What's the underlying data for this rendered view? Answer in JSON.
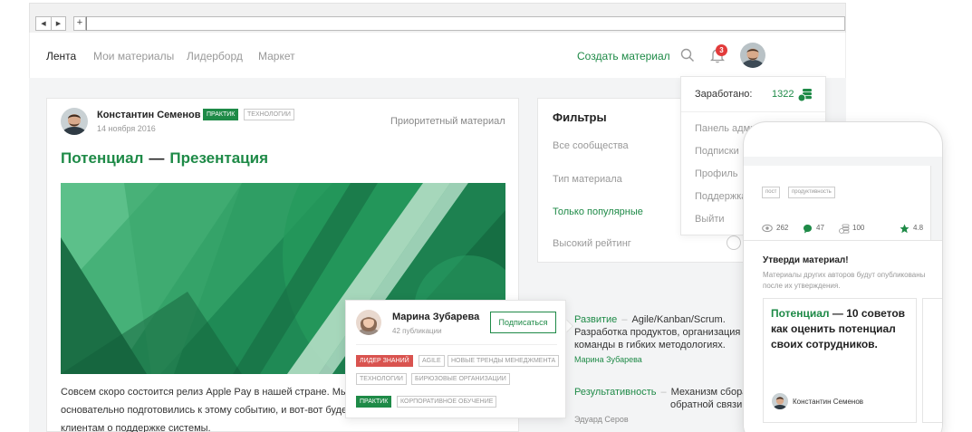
{
  "browser": {
    "back": "◀",
    "forward": "▶",
    "new_tab": "+"
  },
  "header": {
    "nav": [
      "Лента",
      "Мои материалы",
      "Лидерборд",
      "Маркет"
    ],
    "create_label": "Создать материал",
    "notifications_count": "3"
  },
  "post": {
    "author": "Константин Семенов",
    "badge_level": "ПРАКТИК",
    "badge_topic": "ТЕХНОЛОГИИ",
    "date": "14 ноября 2016",
    "priority": "Приоритетный материал",
    "title_part1": "Потенциал",
    "title_dash": "—",
    "title_part2": "Презентация",
    "text_lines": [
      "Совсем скоро состоится релиз Apple Pay в нашей стране. Мы со",
      "основательно подготовились к этому событию, и вот-вот буде",
      "клиентам о поддержке системы."
    ]
  },
  "filters": {
    "title": "Фильтры",
    "items": [
      "Все сообщества",
      "Тип материала",
      "Только популярные",
      "Высокий рейтинг"
    ]
  },
  "feed": [
    {
      "category": "Развитие",
      "sep": "–",
      "lines": [
        "Agile/Kanban/Scrum.",
        "Разработка продуктов, организация",
        "команды в гибких методологиях."
      ],
      "author": "Марина Зубарева"
    },
    {
      "category": "Результативность",
      "sep": "–",
      "lines": [
        "Механизм сбора",
        "обратной связи."
      ],
      "author": "Эдуард Серов"
    }
  ],
  "popover": {
    "name": "Марина Зубарева",
    "count": "42 публикации",
    "subscribe": "Подписаться",
    "tags": [
      "ЛИДЕР ЗНАНИЙ",
      "AGILE",
      "НОВЫЕ ТРЕНДЫ МЕНЕДЖМЕНТА",
      "ТЕХНОЛОГИИ",
      "БИРЮЗОВЫЕ ОРГАНИЗАЦИИ",
      "ПРАКТИК",
      "КОРПОРАТИВНОЕ ОБУЧЕНИЕ"
    ]
  },
  "dropdown": {
    "earned_label": "Заработано:",
    "earned_value": "1322",
    "items": [
      "Панель админ",
      "Подписки",
      "Профиль",
      "Поддержка",
      "Выйти"
    ]
  },
  "phone": {
    "tags": [
      "пост",
      "продуктивность"
    ],
    "views": "262",
    "comments": "47",
    "coins": "100",
    "rating": "4.8",
    "approve_title": "Утверди материал!",
    "approve_sub": "Материалы других авторов будут опубликованы после их утверждения.",
    "card_title_green": "Потенциал",
    "card_title_rest": "— 10 советов как оценить потенциал своих сотрудников.",
    "card_author": "Константин Семенов"
  },
  "colors": {
    "brand": "#1e8a47",
    "badge_red": "#e23b3b",
    "tag_red": "#d9534f"
  }
}
